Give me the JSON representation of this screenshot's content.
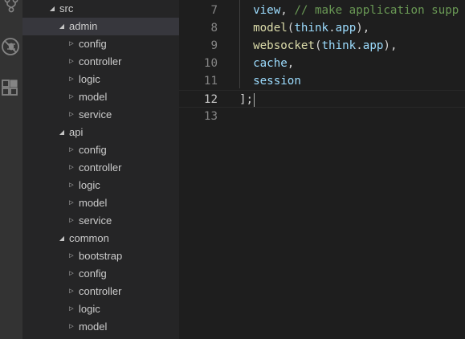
{
  "activity_bar": {
    "icons": [
      "source-control-icon",
      "debug-icon",
      "extensions-icon"
    ]
  },
  "explorer": {
    "rows": [
      {
        "label": "src",
        "level": 0,
        "state": "open",
        "selected": false
      },
      {
        "label": "admin",
        "level": 1,
        "state": "open",
        "selected": true
      },
      {
        "label": "config",
        "level": 2,
        "state": "closed",
        "selected": false
      },
      {
        "label": "controller",
        "level": 2,
        "state": "closed",
        "selected": false
      },
      {
        "label": "logic",
        "level": 2,
        "state": "closed",
        "selected": false
      },
      {
        "label": "model",
        "level": 2,
        "state": "closed",
        "selected": false
      },
      {
        "label": "service",
        "level": 2,
        "state": "closed",
        "selected": false
      },
      {
        "label": "api",
        "level": 1,
        "state": "open",
        "selected": false
      },
      {
        "label": "config",
        "level": 2,
        "state": "closed",
        "selected": false
      },
      {
        "label": "controller",
        "level": 2,
        "state": "closed",
        "selected": false
      },
      {
        "label": "logic",
        "level": 2,
        "state": "closed",
        "selected": false
      },
      {
        "label": "model",
        "level": 2,
        "state": "closed",
        "selected": false
      },
      {
        "label": "service",
        "level": 2,
        "state": "closed",
        "selected": false
      },
      {
        "label": "common",
        "level": 1,
        "state": "open",
        "selected": false
      },
      {
        "label": "bootstrap",
        "level": 2,
        "state": "closed",
        "selected": false
      },
      {
        "label": "config",
        "level": 2,
        "state": "closed",
        "selected": false
      },
      {
        "label": "controller",
        "level": 2,
        "state": "closed",
        "selected": false
      },
      {
        "label": "logic",
        "level": 2,
        "state": "closed",
        "selected": false
      },
      {
        "label": "model",
        "level": 2,
        "state": "closed",
        "selected": false
      }
    ]
  },
  "editor": {
    "active_line": 12,
    "lines": [
      {
        "number": "7",
        "tokens": [
          {
            "t": "  view",
            "c": "var"
          },
          {
            "t": ", ",
            "c": "punc"
          },
          {
            "t": "// make application supp",
            "c": "comment"
          }
        ]
      },
      {
        "number": "8",
        "tokens": [
          {
            "t": "  model",
            "c": "fn"
          },
          {
            "t": "(",
            "c": "punc"
          },
          {
            "t": "think",
            "c": "var"
          },
          {
            "t": ".",
            "c": "punc"
          },
          {
            "t": "app",
            "c": "var"
          },
          {
            "t": "),",
            "c": "punc"
          }
        ]
      },
      {
        "number": "9",
        "tokens": [
          {
            "t": "  websocket",
            "c": "fn"
          },
          {
            "t": "(",
            "c": "punc"
          },
          {
            "t": "think",
            "c": "var"
          },
          {
            "t": ".",
            "c": "punc"
          },
          {
            "t": "app",
            "c": "var"
          },
          {
            "t": "),",
            "c": "punc"
          }
        ]
      },
      {
        "number": "10",
        "tokens": [
          {
            "t": "  cache",
            "c": "var"
          },
          {
            "t": ",",
            "c": "punc"
          }
        ]
      },
      {
        "number": "11",
        "tokens": [
          {
            "t": "  session",
            "c": "var"
          }
        ]
      },
      {
        "number": "12",
        "tokens": [
          {
            "t": "];",
            "c": "punc"
          }
        ]
      },
      {
        "number": "13",
        "tokens": []
      }
    ]
  },
  "colors": {
    "activity_bar_bg": "#333333",
    "sidebar_bg": "#252526",
    "selected_row_bg": "#37373d",
    "editor_bg": "#1e1e1e",
    "function": "#dcdcaa",
    "variable": "#9cdcfe",
    "comment": "#6a9955"
  }
}
